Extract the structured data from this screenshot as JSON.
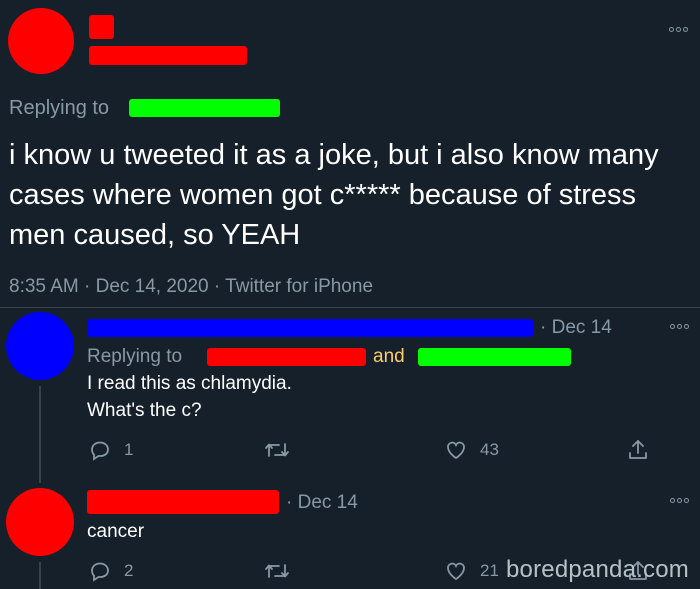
{
  "main_tweet": {
    "replying_to_label": "Replying to",
    "text": "i know u tweeted it as a joke, but i also know many cases where women got c***** because of stress men caused, so YEAH",
    "meta": "8:35 AM · Dec 14, 2020 · Twitter for iPhone"
  },
  "reply_1": {
    "date": "· Dec 14",
    "replying_to_label": "Replying to",
    "and_label": "and",
    "text_line1": "I read this as chlamydia.",
    "text_line2": "What's the c?",
    "reply_count": "1",
    "like_count": "43"
  },
  "reply_2": {
    "date": "· Dec 14",
    "text": "cancer",
    "reply_count": "2",
    "like_count": "21"
  },
  "watermark": "boredpanda.com",
  "colors": {
    "background": "#15202b",
    "secondary_text": "#8899a6",
    "redact_red": "#ff0000",
    "redact_green": "#00ff00",
    "redact_blue": "#0000ff"
  }
}
